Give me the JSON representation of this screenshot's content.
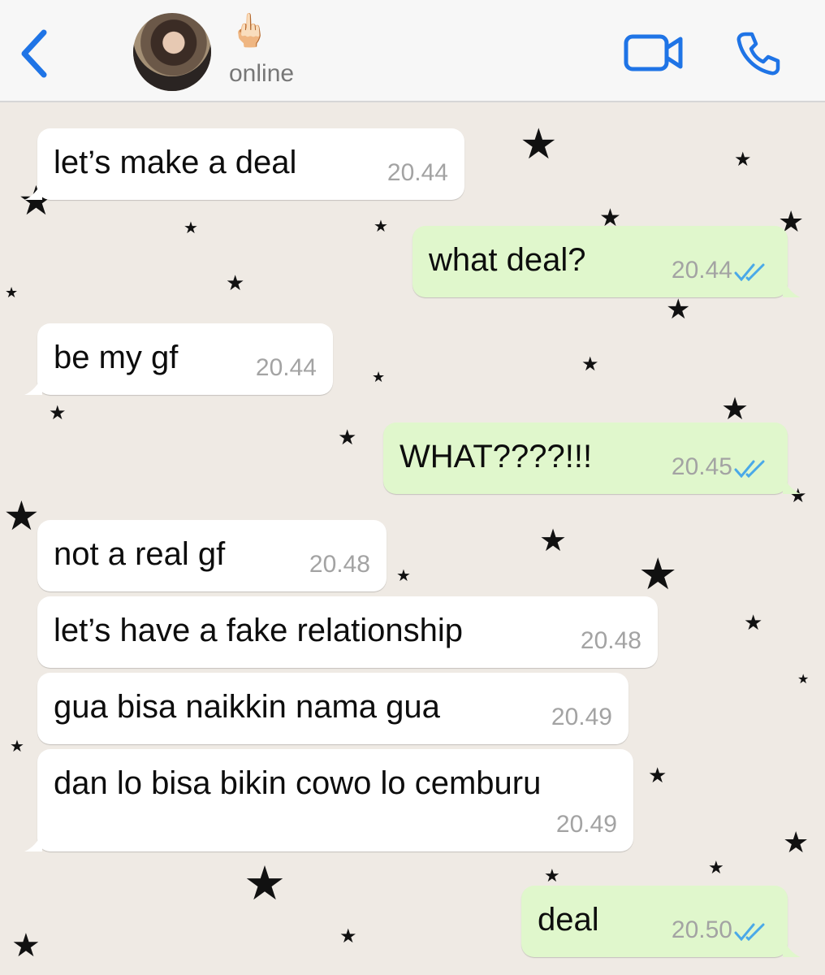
{
  "header": {
    "back_icon": "chevron-left-icon",
    "avatar_alt": "contact avatar",
    "status_emoji": "🖕🏻",
    "status": "online",
    "video_icon": "video-camera-icon",
    "call_icon": "phone-icon",
    "accent_color": "#1f74e6"
  },
  "chat": {
    "colors": {
      "incoming_bg": "#ffffff",
      "outgoing_bg": "#e0f7cc",
      "time": "#a3a3a3",
      "read_ticks": "#4aa9e8",
      "wallpaper": "#efeae4"
    },
    "messages": [
      {
        "direction": "incoming",
        "text": "let’s make a deal",
        "time": "20.44"
      },
      {
        "direction": "outgoing",
        "text": "what deal?",
        "time": "20.44",
        "status": "read"
      },
      {
        "direction": "incoming",
        "text": "be my gf",
        "time": "20.44"
      },
      {
        "direction": "outgoing",
        "text": "WHAT????!!!",
        "time": "20.45",
        "status": "read"
      },
      {
        "direction": "incoming",
        "text": "not a real gf",
        "time": "20.48"
      },
      {
        "direction": "incoming",
        "text": "let’s have a fake relationship",
        "time": "20.48"
      },
      {
        "direction": "incoming",
        "text": "gua bisa naikkin nama gua",
        "time": "20.49"
      },
      {
        "direction": "incoming",
        "text": "dan lo bisa bikin cowo lo cemburu",
        "time": "20.49"
      },
      {
        "direction": "outgoing",
        "text": "deal",
        "time": "20.50",
        "status": "read"
      }
    ]
  }
}
